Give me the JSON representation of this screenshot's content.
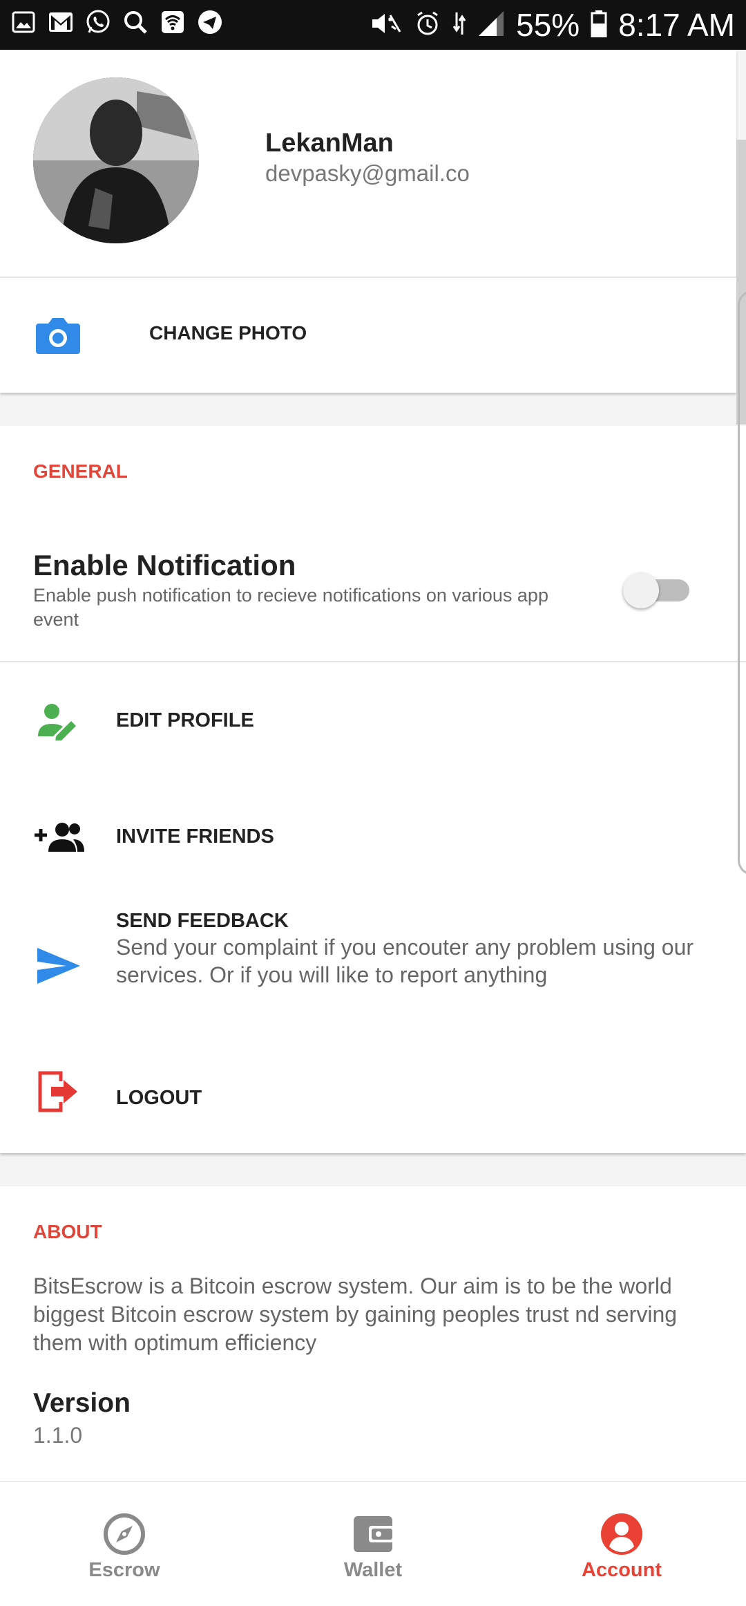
{
  "status_bar": {
    "left_icons": [
      "gallery-icon",
      "gmail-icon",
      "whatsapp-icon",
      "search-icon",
      "wifi-calling-icon",
      "telegram-icon"
    ],
    "battery": "55%",
    "time": "8:17 AM"
  },
  "profile": {
    "name": "LekanMan",
    "email": "devpasky@gmail.co",
    "change_photo_label": "CHANGE PHOTO"
  },
  "general": {
    "section_title": "GENERAL",
    "notification": {
      "title": "Enable Notification",
      "description": "Enable push notification to recieve notifications on various app event",
      "enabled": false
    },
    "menu": [
      {
        "label": "EDIT PROFILE",
        "icon": "edit-profile-icon"
      },
      {
        "label": "INVITE FRIENDS",
        "icon": "invite-friends-icon"
      },
      {
        "label": "SEND FEEDBACK",
        "description": "Send your complaint if you encouter any problem using our services. Or if you will like to report anything",
        "icon": "send-icon"
      },
      {
        "label": "LOGOUT",
        "icon": "logout-icon"
      }
    ]
  },
  "about": {
    "section_title": "ABOUT",
    "text": "BitsEscrow is a Bitcoin escrow system. Our aim is to be the world biggest Bitcoin escrow system by gaining peoples trust nd serving them with optimum efficiency",
    "version_title": "Version",
    "version_value": "1.1.0"
  },
  "bottom_nav": {
    "items": [
      {
        "label": "Escrow",
        "icon": "compass-icon",
        "active": false
      },
      {
        "label": "Wallet",
        "icon": "wallet-icon",
        "active": false
      },
      {
        "label": "Account",
        "icon": "account-icon",
        "active": true
      }
    ]
  },
  "colors": {
    "accent": "#e94235",
    "section_header": "#e0473a",
    "camera_blue": "#2f8ae8",
    "edit_green": "#4caf50",
    "logout_red": "#e53935"
  }
}
